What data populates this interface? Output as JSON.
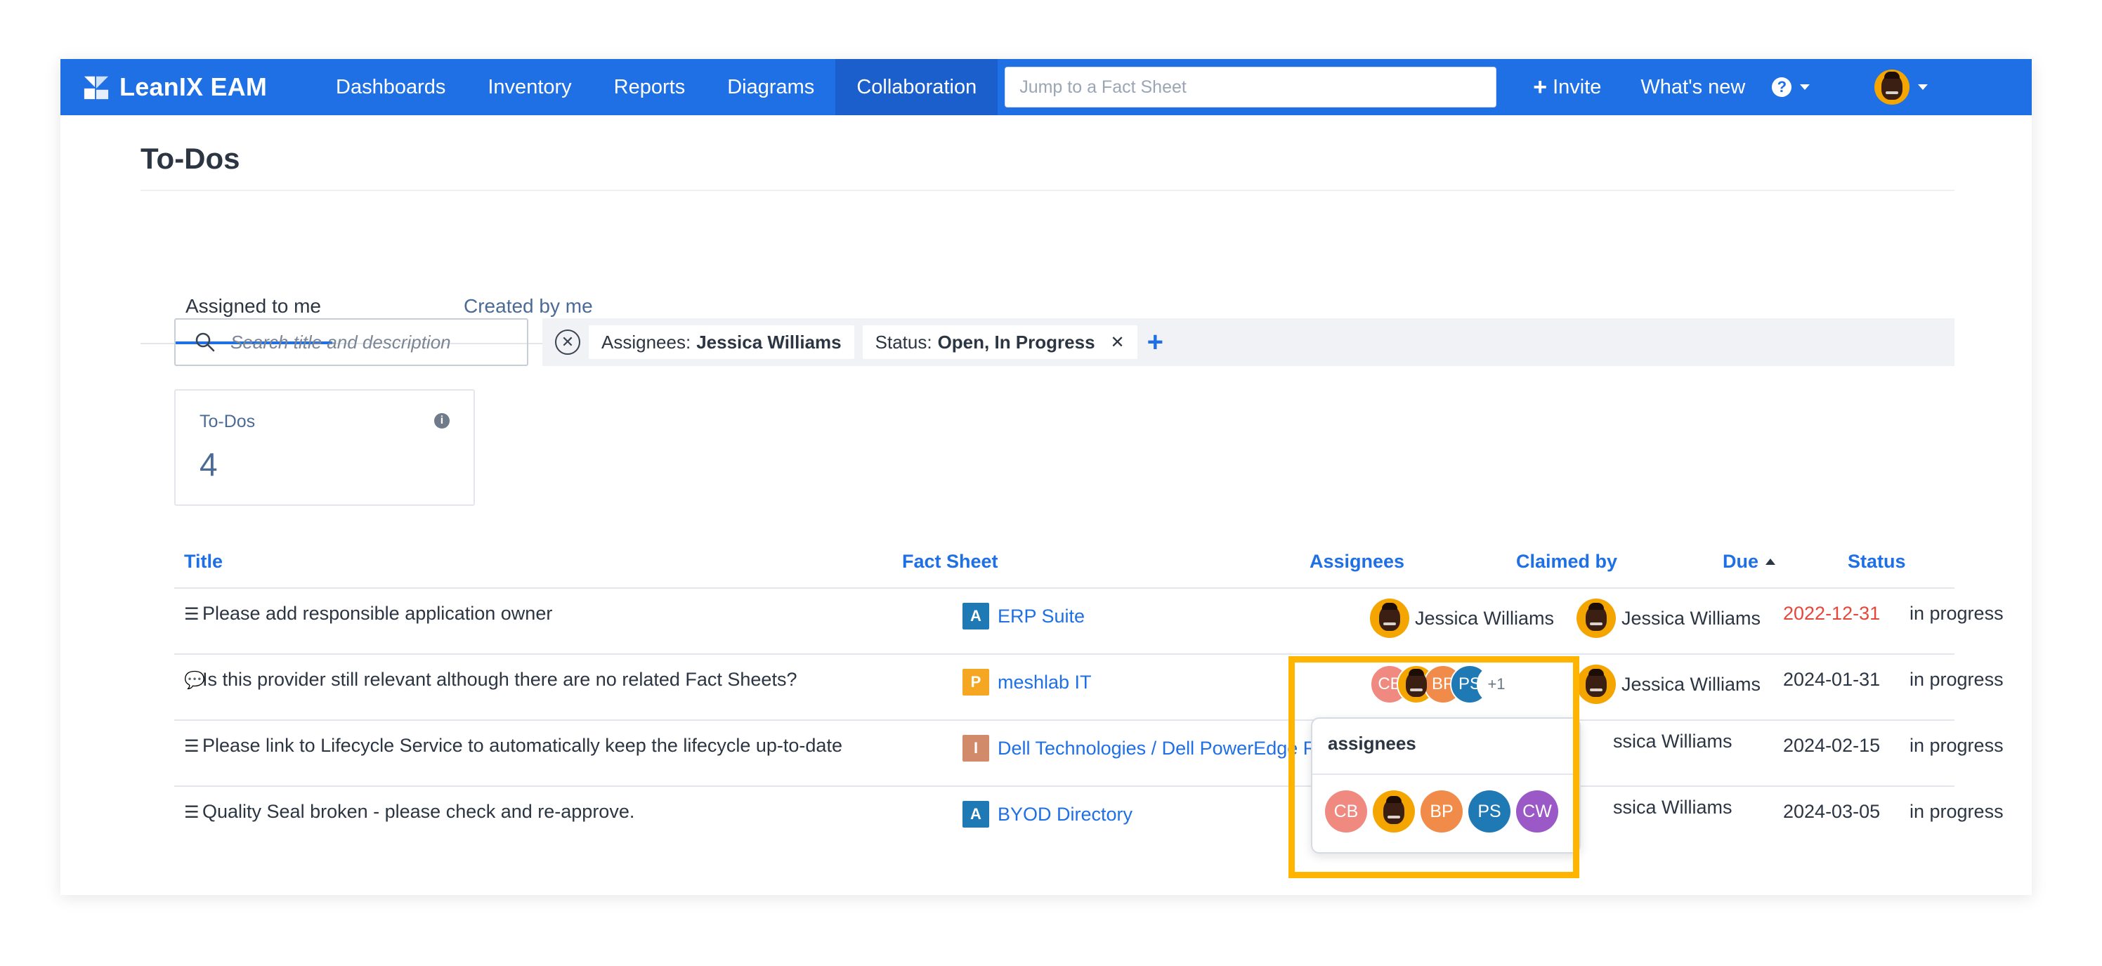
{
  "nav": {
    "brand": "LeanIX EAM",
    "items": [
      {
        "label": "Dashboards",
        "active": false
      },
      {
        "label": "Inventory",
        "active": false
      },
      {
        "label": "Reports",
        "active": false
      },
      {
        "label": "Diagrams",
        "active": false
      },
      {
        "label": "Collaboration",
        "active": true
      }
    ],
    "search_placeholder": "Jump to a Fact Sheet",
    "invite_label": "Invite",
    "whats_new_label": "What's new",
    "help_icon": "question-circle-icon",
    "accent_color": "#1f6fe5"
  },
  "page": {
    "title": "To-Dos",
    "tabs": [
      {
        "label": "Assigned to me",
        "active": true
      },
      {
        "label": "Created by me",
        "active": false
      }
    ],
    "search_placeholder": "Search title and description",
    "filters": [
      {
        "label": "Assignees:",
        "value": "Jessica Williams",
        "removable": false
      },
      {
        "label": "Status:",
        "value": "Open,  In Progress",
        "removable": true
      }
    ],
    "summary_card": {
      "label": "To-Dos",
      "value": "4"
    }
  },
  "table": {
    "columns": [
      "Title",
      "Fact Sheet",
      "Assignees",
      "Claimed by",
      "Due",
      "Status"
    ],
    "sort_column": "Due",
    "rows": [
      {
        "icon": "checklist-icon",
        "title": "Please add responsible application owner",
        "fact_sheet_badge": "A",
        "badge_color": "#1e79b4",
        "fact_sheet": "ERP Suite",
        "assignee": "Jessica Williams",
        "claimed_by": "Jessica Williams",
        "due": "2022-12-31",
        "overdue": true,
        "status": "in progress"
      },
      {
        "icon": "comment-icon",
        "title": "Is this provider still relevant although there are no related Fact Sheets?",
        "fact_sheet_badge": "P",
        "badge_color": "#f5a623",
        "fact_sheet": "meshlab IT",
        "assignee": "",
        "claimed_by": "Jessica Williams",
        "due": "2024-01-31",
        "overdue": false,
        "status": "in progress"
      },
      {
        "icon": "checklist-icon",
        "title": "Please link to Lifecycle Service to automatically keep the lifecycle up-to-date",
        "fact_sheet_badge": "I",
        "badge_color": "#d18b6a",
        "fact_sheet": "Dell Technologies / Dell PowerEdge R640",
        "assignee": "",
        "claimed_by": "ssica Williams",
        "due": "2024-02-15",
        "overdue": false,
        "status": "in progress"
      },
      {
        "icon": "checklist-icon",
        "title": "Quality Seal broken - please check and re-approve.",
        "fact_sheet_badge": "A",
        "badge_color": "#1e79b4",
        "fact_sheet": "BYOD Directory",
        "assignee": "",
        "claimed_by": "ssica Williams",
        "due": "2024-03-05",
        "overdue": false,
        "status": "in progress"
      }
    ],
    "row2_assignee_stack": [
      "CB",
      "",
      "BP",
      "PS"
    ],
    "row2_more_count": "+1"
  },
  "popover": {
    "title": "assignees",
    "avatars": [
      "CB",
      "",
      "BP",
      "PS",
      "CW"
    ]
  },
  "highlight_color": "#ffb400"
}
